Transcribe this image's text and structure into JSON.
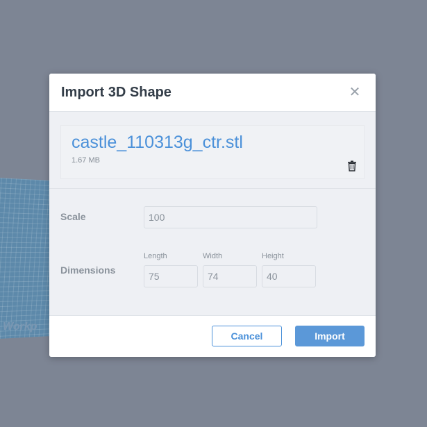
{
  "background": {
    "workplane_label": "Workp"
  },
  "dialog": {
    "title": "Import 3D Shape",
    "close_icon": "close-icon",
    "file": {
      "name": "castle_110313g_ctr.stl",
      "size": "1.67 MB",
      "delete_icon": "trash-icon"
    },
    "scale": {
      "label": "Scale",
      "value": "100"
    },
    "dimensions": {
      "label": "Dimensions",
      "length_label": "Length",
      "length_value": "75",
      "width_label": "Width",
      "width_value": "74",
      "height_label": "Height",
      "height_value": "40"
    },
    "buttons": {
      "cancel": "Cancel",
      "import": "Import"
    }
  },
  "colors": {
    "accent": "#4a90d9",
    "backdrop": "#7d8594",
    "import_button": "#5b98d8"
  }
}
